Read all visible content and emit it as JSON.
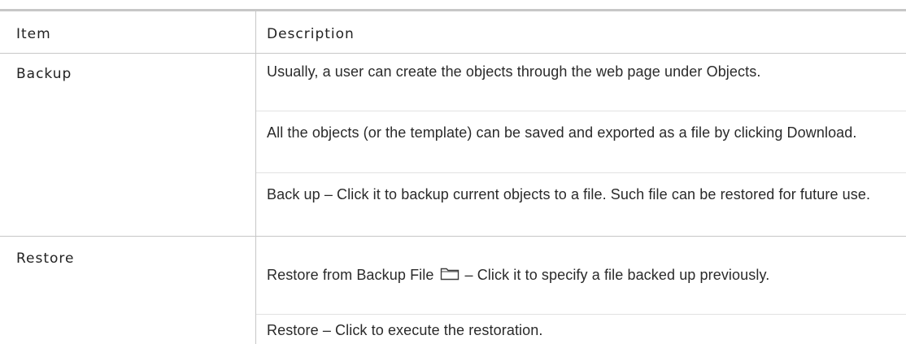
{
  "table": {
    "header": {
      "item": "Item",
      "description": "Description"
    },
    "rows": [
      {
        "item": "Backup",
        "paragraphs": [
          "Usually, a user can create the objects through the web page under Objects.",
          "All the objects (or the template) can be saved and exported as a file by clicking Download.",
          "Back up – Click it to backup current objects to a file. Such file can be restored for future use."
        ]
      },
      {
        "item": "Restore",
        "restore_from_backup_label": "Restore from Backup File",
        "restore_from_backup_icon": "folder-icon",
        "restore_from_backup_desc": "– Click it to specify a file backed up previously.",
        "restore_desc": "Restore – Click to execute the restoration."
      }
    ]
  }
}
